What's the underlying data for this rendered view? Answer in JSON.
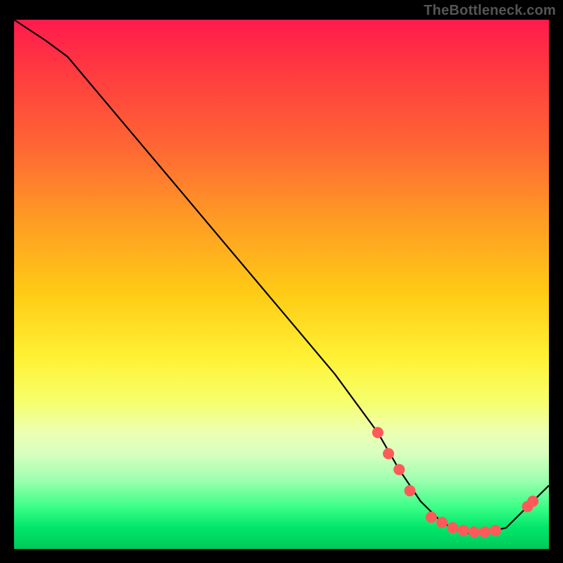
{
  "watermark": "TheBottleneck.com",
  "chart_data": {
    "type": "line",
    "title": "",
    "xlabel": "",
    "ylabel": "",
    "xlim": [
      0,
      100
    ],
    "ylim": [
      0,
      100
    ],
    "series": [
      {
        "name": "curve",
        "x": [
          0,
          6,
          10,
          20,
          30,
          40,
          50,
          60,
          68,
          72,
          76,
          80,
          84,
          88,
          92,
          96,
          100
        ],
        "y": [
          100,
          96,
          93,
          81,
          69,
          57,
          45,
          33,
          22,
          15,
          9,
          5,
          3,
          3,
          4,
          8,
          12
        ]
      }
    ],
    "markers": [
      {
        "x": 68,
        "y": 22
      },
      {
        "x": 70,
        "y": 18
      },
      {
        "x": 72,
        "y": 15
      },
      {
        "x": 74,
        "y": 11
      },
      {
        "x": 78,
        "y": 6
      },
      {
        "x": 80,
        "y": 5
      },
      {
        "x": 82,
        "y": 4
      },
      {
        "x": 84,
        "y": 3.5
      },
      {
        "x": 86,
        "y": 3.2
      },
      {
        "x": 88,
        "y": 3.2
      },
      {
        "x": 90,
        "y": 3.5
      },
      {
        "x": 96,
        "y": 8
      },
      {
        "x": 97,
        "y": 9
      }
    ],
    "gradient_stops": [
      {
        "pos": 0,
        "color": "#ff1a4d"
      },
      {
        "pos": 25,
        "color": "#ff6a33"
      },
      {
        "pos": 52,
        "color": "#ffcc15"
      },
      {
        "pos": 72,
        "color": "#f7ff6b"
      },
      {
        "pos": 92,
        "color": "#3cff87"
      },
      {
        "pos": 100,
        "color": "#00c95c"
      }
    ],
    "marker_color": "#ff5a5a",
    "line_color": "#000000"
  }
}
